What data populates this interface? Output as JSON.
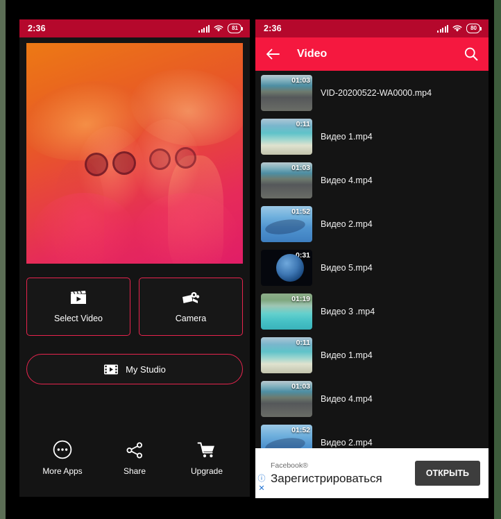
{
  "left_phone": {
    "status_bar": {
      "time": "2:36",
      "battery": "81",
      "signal_icon": "cellular-signal-icon",
      "wifi_icon": "wifi-icon"
    },
    "hero": {
      "name": "duotone-photo-two-women-hats-sunglasses"
    },
    "actions": [
      {
        "label": "Select Video",
        "icon": "clapperboard-icon",
        "name": "select-video"
      },
      {
        "label": "Camera",
        "icon": "video-camera-icon",
        "name": "camera"
      }
    ],
    "studio": {
      "label": "My Studio",
      "icon": "film-strip-icon"
    },
    "bottom_nav": [
      {
        "label": "More Apps",
        "icon": "more-circle-icon"
      },
      {
        "label": "Share",
        "icon": "share-icon"
      },
      {
        "label": "Upgrade",
        "icon": "shopping-cart-icon"
      }
    ]
  },
  "right_phone": {
    "status_bar": {
      "time": "2:36",
      "battery": "80",
      "signal_icon": "cellular-signal-icon",
      "wifi_icon": "wifi-icon"
    },
    "appbar": {
      "title": "Video",
      "back_icon": "arrow-back-icon",
      "search_icon": "search-icon"
    },
    "videos": [
      {
        "name": "VID-20200522-WA0000.mp4",
        "duration": "01:03",
        "thumb": "th-coast"
      },
      {
        "name": "Видео 1.mp4",
        "duration": "0:11",
        "thumb": "th-beach"
      },
      {
        "name": "Видео 4.mp4",
        "duration": "01:03",
        "thumb": "th-coast"
      },
      {
        "name": "Видео 2.mp4",
        "duration": "01:52",
        "thumb": "th-reef"
      },
      {
        "name": "Видео 5.mp4",
        "duration": "0:31",
        "thumb": "th-earth"
      },
      {
        "name": "Видео 3 .mp4",
        "duration": "01:19",
        "thumb": "th-lagoon"
      },
      {
        "name": "Видео 1.mp4",
        "duration": "0:11",
        "thumb": "th-beach"
      },
      {
        "name": "Видео 4.mp4",
        "duration": "01:03",
        "thumb": "th-coast"
      },
      {
        "name": "Видео 2.mp4",
        "duration": "01:52",
        "thumb": "th-reef"
      }
    ],
    "ad": {
      "brand": "Facebook®",
      "headline": "Зарегистрироваться",
      "cta": "ОТКРЫТЬ",
      "info_mark": "ⓘ",
      "close_mark": "✕"
    }
  },
  "colors": {
    "status_red": "#b5082c",
    "appbar_red": "#f5183f",
    "accent_outline": "#e8244e",
    "screen_bg": "#141414",
    "page_bg": "#5c6e56"
  }
}
